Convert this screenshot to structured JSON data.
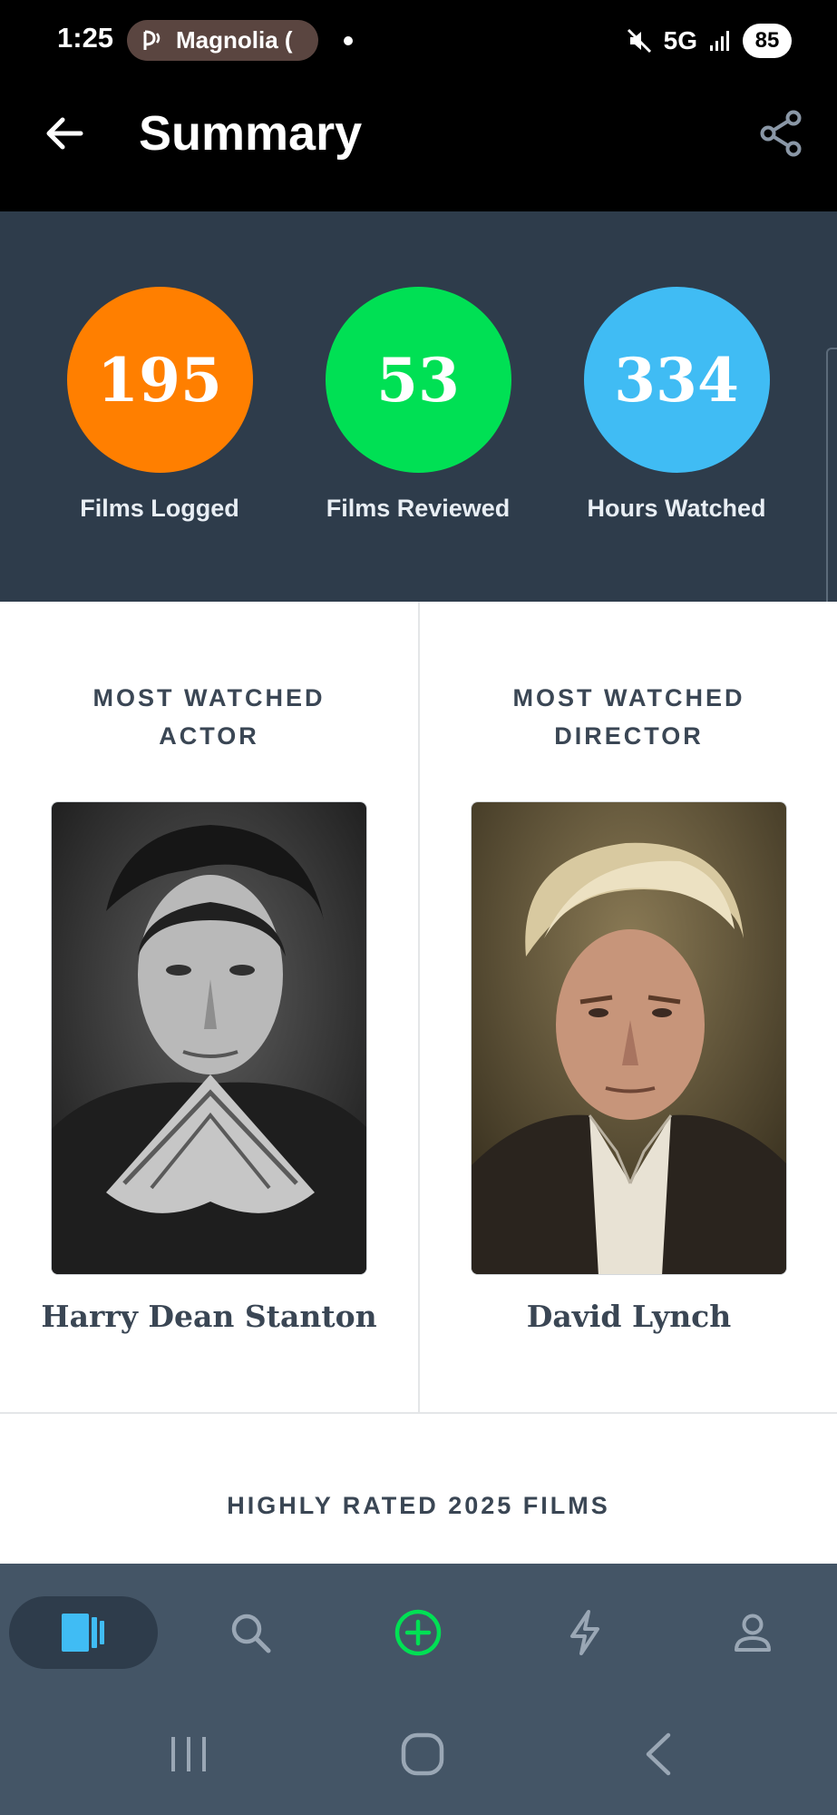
{
  "status_bar": {
    "time": "1:25",
    "media_app": "Magnolia (",
    "network": "5G",
    "battery": "85"
  },
  "header": {
    "title": "Summary"
  },
  "stats": [
    {
      "value": "195",
      "label": "Films Logged",
      "color": "#ff7f00"
    },
    {
      "value": "53",
      "label": "Films Reviewed",
      "color": "#00e054"
    },
    {
      "value": "334",
      "label": "Hours Watched",
      "color": "#40bcf4"
    }
  ],
  "people": {
    "actor": {
      "heading_line1": "MOST WATCHED",
      "heading_line2": "ACTOR",
      "name": "Harry Dean Stanton"
    },
    "director": {
      "heading_line1": "MOST WATCHED",
      "heading_line2": "DIRECTOR",
      "name": "David Lynch"
    }
  },
  "highly_rated": {
    "title": "HIGHLY RATED 2025 FILMS"
  },
  "bottom_nav": {
    "items": [
      {
        "icon": "films-icon",
        "active": true
      },
      {
        "icon": "search-icon"
      },
      {
        "icon": "add-icon"
      },
      {
        "icon": "activity-icon"
      },
      {
        "icon": "profile-icon"
      }
    ],
    "active_color": "#40bcf4",
    "add_color": "#00e054"
  }
}
